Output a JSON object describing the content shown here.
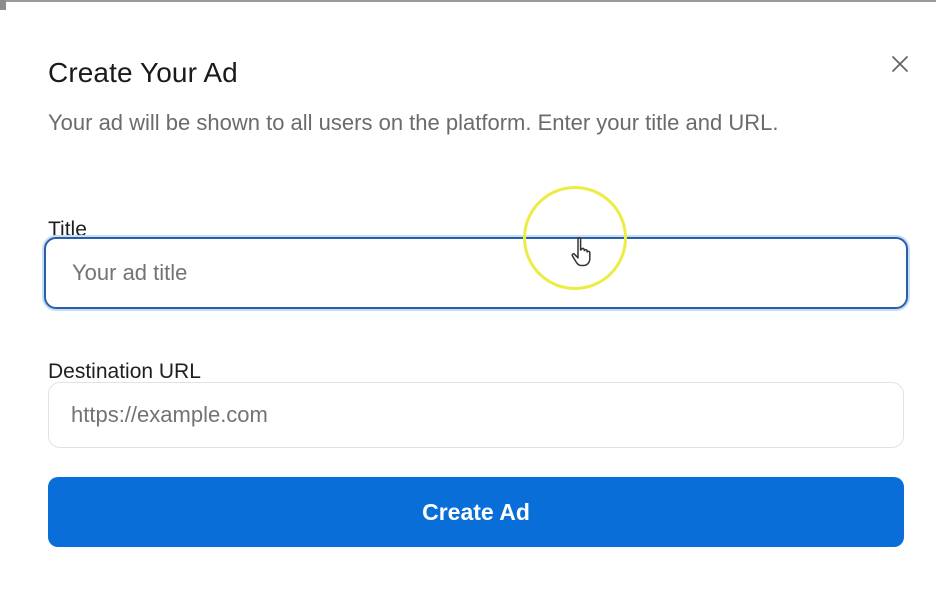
{
  "dialog": {
    "title": "Create Your Ad",
    "description": "Your ad will be shown to all users on the platform. Enter your title and URL.",
    "close_icon": "close-icon"
  },
  "form": {
    "title_field": {
      "label": "Title",
      "value": "",
      "placeholder": "Your ad title",
      "focused": true
    },
    "url_field": {
      "label": "Destination URL",
      "value": "",
      "placeholder": "https://example.com"
    },
    "submit": {
      "label": "Create Ad"
    }
  },
  "overlay": {
    "cursor_icon": "hand-pointer-icon",
    "highlight_icon": "cursor-highlight-ring"
  },
  "colors": {
    "primary_button": "#0a6ed8",
    "focus_border": "#2a5fa8",
    "cursor_highlight": "#ecec45",
    "title_text": "#1a1a1a",
    "description_text": "#6b6b6b"
  }
}
